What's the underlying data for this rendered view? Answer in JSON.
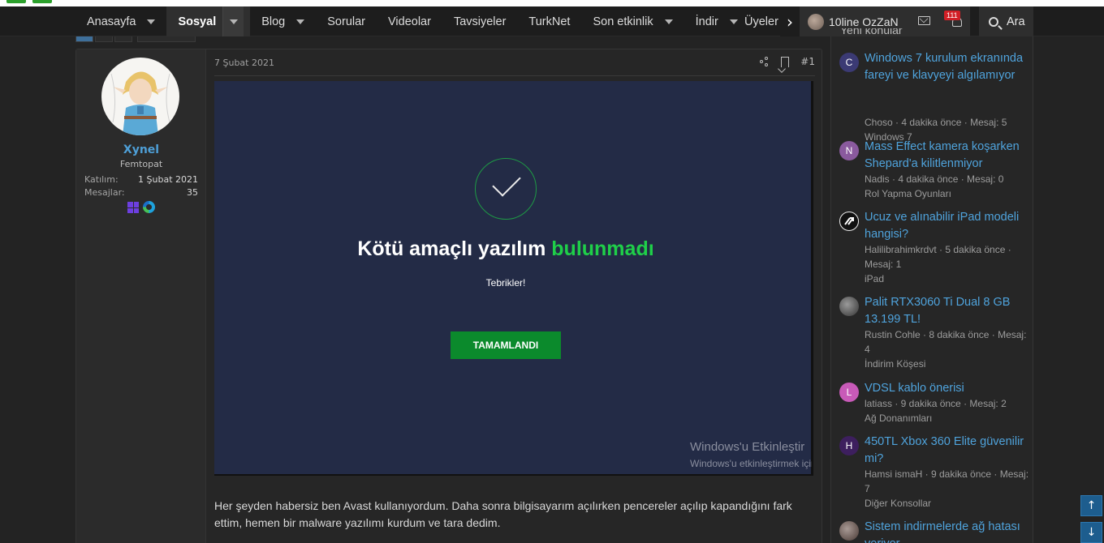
{
  "nav": {
    "items": [
      {
        "label": "Anasayfa",
        "caret": true
      },
      {
        "label": "Sosyal",
        "caret": true,
        "active": true
      },
      {
        "label": "Blog",
        "caret": true
      },
      {
        "label": "Sorular",
        "caret": false
      },
      {
        "label": "Videolar",
        "caret": false
      },
      {
        "label": "Tavsiyeler",
        "caret": false
      },
      {
        "label": "TurkNet",
        "caret": false
      },
      {
        "label": "Son etkinlik",
        "caret": true
      },
      {
        "label": "İndir",
        "caret": true
      }
    ],
    "overflow_label": "Üyeler",
    "next_icon": "chevron-right-icon",
    "user_name": "10line OzZaN",
    "alerts_badge": "111",
    "search_label": "Ara"
  },
  "post": {
    "author": {
      "name": "Xynel",
      "title": "Femtopat",
      "joined_label": "Katılım:",
      "joined_value": "1 Şubat 2021",
      "messages_label": "Mesajlar:",
      "messages_value": "35",
      "os_icons": [
        "windows-icon",
        "edge-icon"
      ]
    },
    "date": "7 Şubat 2021",
    "number": "#1",
    "screenshot": {
      "headline_part1": "Kötü amaçlı yazılım ",
      "headline_part2": "bulunmadı",
      "subline": "Tebrikler!",
      "button": "TAMAMLANDI",
      "watermark_title": "Windows'u Etkinleştir",
      "watermark_sub": "Windows'u etkinleştirmek için",
      "colors": {
        "background": "#232b46",
        "accent": "#1fcf49",
        "button": "#0b8a2c"
      }
    },
    "body": "Her şeyden habersiz ben Avast kullanıyordum. Daha sonra bilgisayarım açılırken pencereler açılıp kapandığını fark ettim, hemen bir malware yazılımı kurdum ve tara dedim."
  },
  "sidebar": {
    "heading": "Yeni konular",
    "threads": [
      {
        "initial": "C",
        "color": "#3b3a74",
        "title": "Windows 7 kurulum ekranında fareyi ve klavyeyi algılamıyor",
        "meta": "Choso · 4 dakika önce · Mesaj: 5",
        "forum": "Windows 7"
      },
      {
        "initial": "N",
        "color": "#8a5a9e",
        "title": "Mass Effect kamera koşarken Shepard'a kilitlenmiyor",
        "meta": "Nadis · 4 dakika önce · Mesaj: 0",
        "forum": "Rol Yapma Oyunları"
      },
      {
        "initial": "",
        "color": "#111111",
        "title": "Ucuz ve alınabilir iPad modeli hangisi?",
        "meta": "Halilibrahimkrdvt · 5 dakika önce · Mesaj: 1",
        "forum": "iPad"
      },
      {
        "initial": "",
        "color": "#5a5a5a",
        "title": "Palit RTX3060 Ti Dual 8 GB 13.199 TL!",
        "meta": "Rustin Cohle · 8 dakika önce · Mesaj: 4",
        "forum": "İndirim Köşesi"
      },
      {
        "initial": "L",
        "color": "#c85ab8",
        "title": "VDSL kablo önerisi",
        "meta": "latiass · 9 dakika önce · Mesaj: 2",
        "forum": "Ağ Donanımları"
      },
      {
        "initial": "H",
        "color": "#3d1f5e",
        "title": "450TL Xbox 360 Elite güvenilir mi?",
        "meta": "Hamsi ismaH · 9 dakika önce · Mesaj: 7",
        "forum": "Diğer Konsollar"
      },
      {
        "initial": "",
        "color": "#6a5a55",
        "title": "Sistem indirmelerde ağ hatası veriyor",
        "meta": "",
        "forum": ""
      }
    ]
  }
}
